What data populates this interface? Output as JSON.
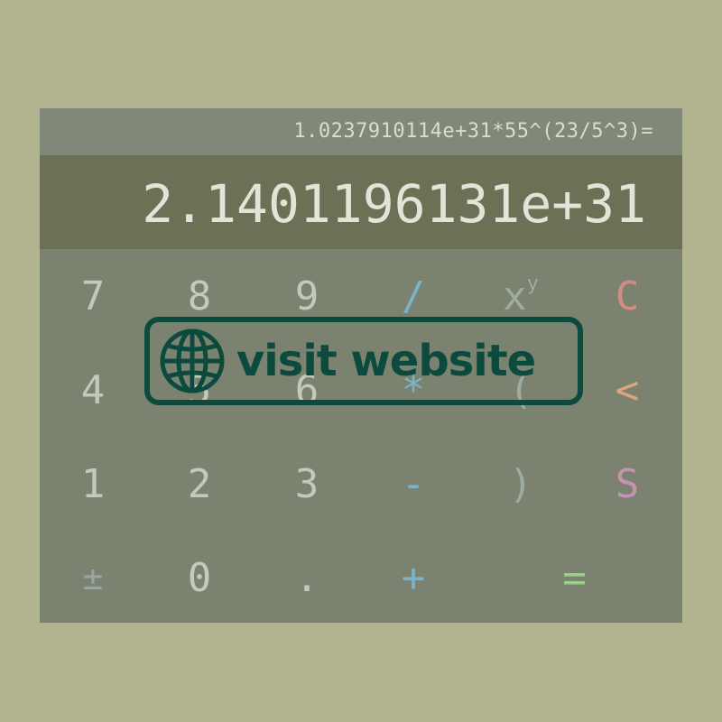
{
  "display": {
    "expression": "1.0237910114e+31*55^(23/5^3)=",
    "result": "2.1401196131e+31"
  },
  "keys": {
    "seven": "7",
    "eight": "8",
    "nine": "9",
    "divide": "/",
    "power_base": "x",
    "power_exp": "y",
    "clear": "C",
    "four": "4",
    "five": "5",
    "six": "6",
    "multiply": "*",
    "open_paren": "(",
    "backspace": "<",
    "one": "1",
    "two": "2",
    "three": "3",
    "minus": "-",
    "close_paren": ")",
    "store": "S",
    "plus_minus": "±",
    "zero": "0",
    "decimal": ".",
    "plus": "+",
    "equals": "="
  },
  "overlay": {
    "label": "visit website",
    "icon": "globe-icon"
  },
  "colors": {
    "background": "#b1b48f",
    "result_bar": "#6c7054",
    "overlay_accent": "#0b4a3c",
    "clear": "#d58b83",
    "backspace": "#dba57e",
    "store": "#c592b5",
    "equals": "#9bcf8a",
    "operator": "#7bb2c6"
  }
}
